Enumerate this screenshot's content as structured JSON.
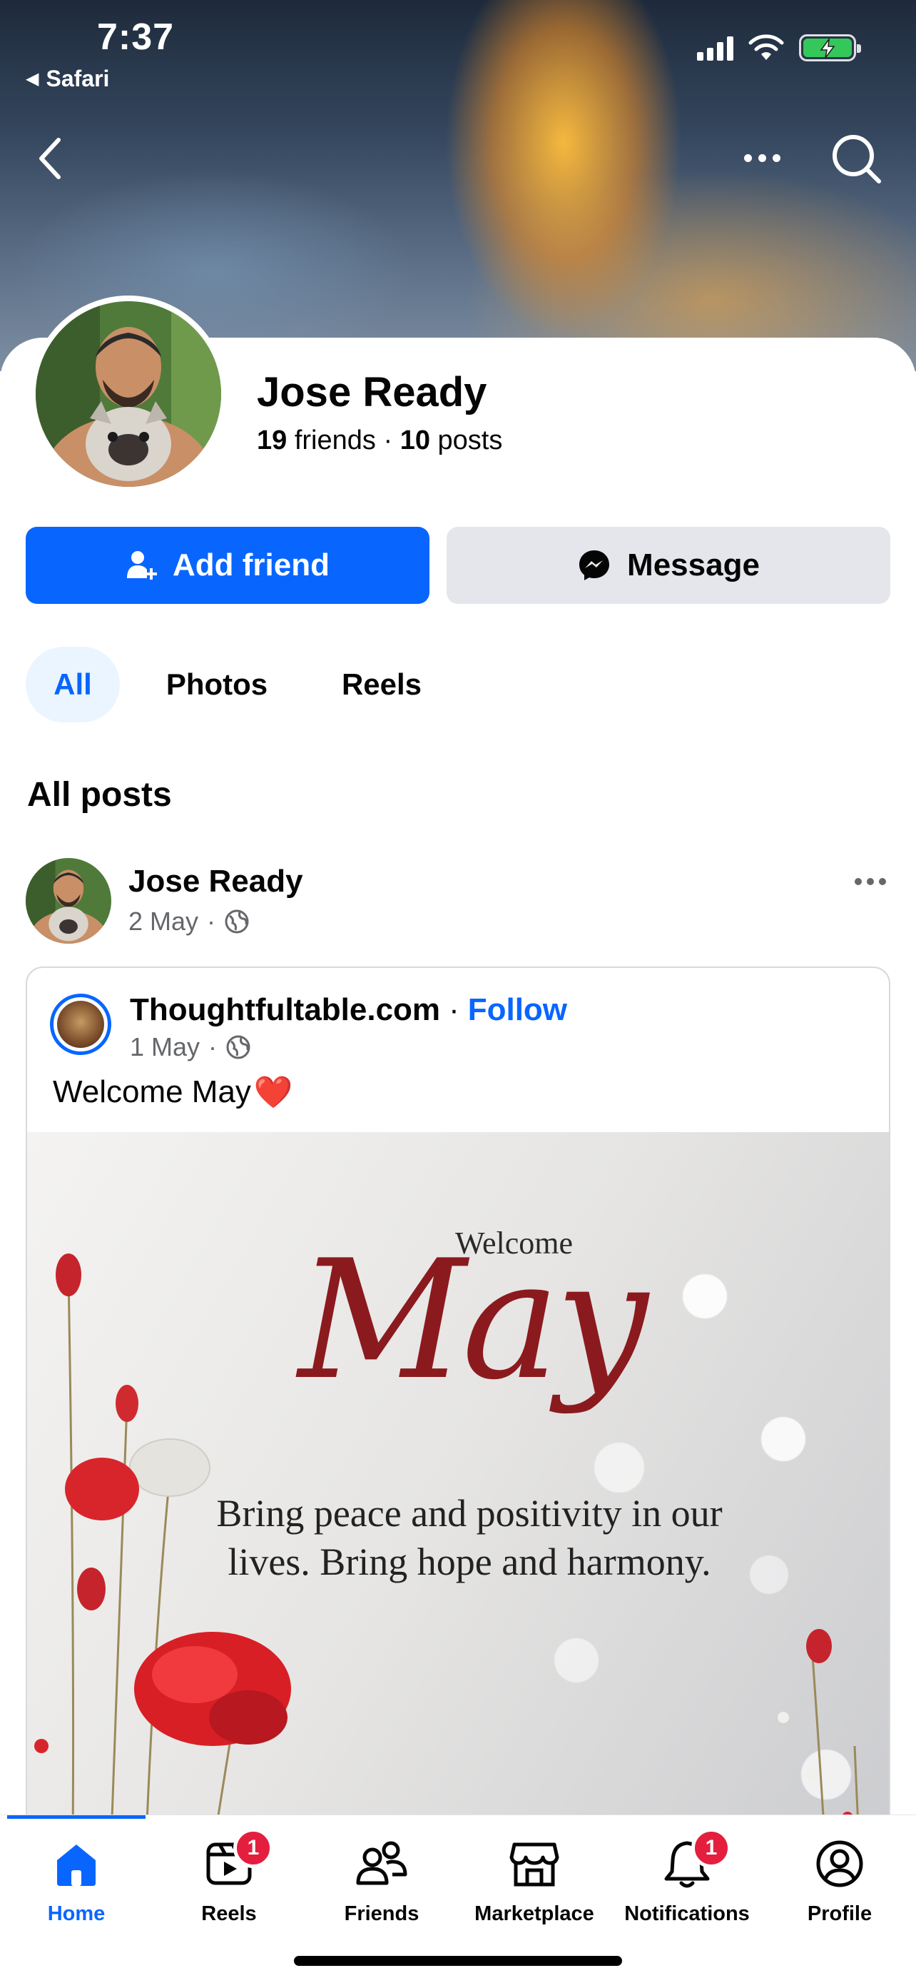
{
  "status": {
    "time": "7:37",
    "back_app": "Safari"
  },
  "profile": {
    "name": "Jose Ready",
    "friends_count": "19",
    "friends_label": "friends",
    "separator": "·",
    "posts_count": "10",
    "posts_label": "posts"
  },
  "actions": {
    "add_friend": "Add friend",
    "message": "Message"
  },
  "filters": [
    "All",
    "Photos",
    "Reels"
  ],
  "section_title": "All posts",
  "post": {
    "author": "Jose Ready",
    "date": "2 May",
    "audience_icon": "globe-icon",
    "shared": {
      "page_name": "Thoughtfultable.com",
      "dot": "·",
      "follow": "Follow",
      "date": "1 May",
      "text": "Welcome May",
      "text_emoji": "❤️",
      "image": {
        "welcome": "Welcome",
        "month": "May",
        "quote": "Bring peace and positivity in our lives. Bring hope and harmony."
      }
    }
  },
  "bottom_nav": [
    {
      "label": "Home",
      "icon": "home-icon",
      "active": true
    },
    {
      "label": "Reels",
      "icon": "reels-icon",
      "badge": "1"
    },
    {
      "label": "Friends",
      "icon": "friends-icon"
    },
    {
      "label": "Marketplace",
      "icon": "marketplace-icon"
    },
    {
      "label": "Notifications",
      "icon": "bell-icon",
      "badge": "1"
    },
    {
      "label": "Profile",
      "icon": "profile-icon"
    }
  ],
  "colors": {
    "accent": "#0866ff",
    "badge": "#e41e3f",
    "secondary_button": "#e4e6eb",
    "muted_text": "#65676b"
  }
}
